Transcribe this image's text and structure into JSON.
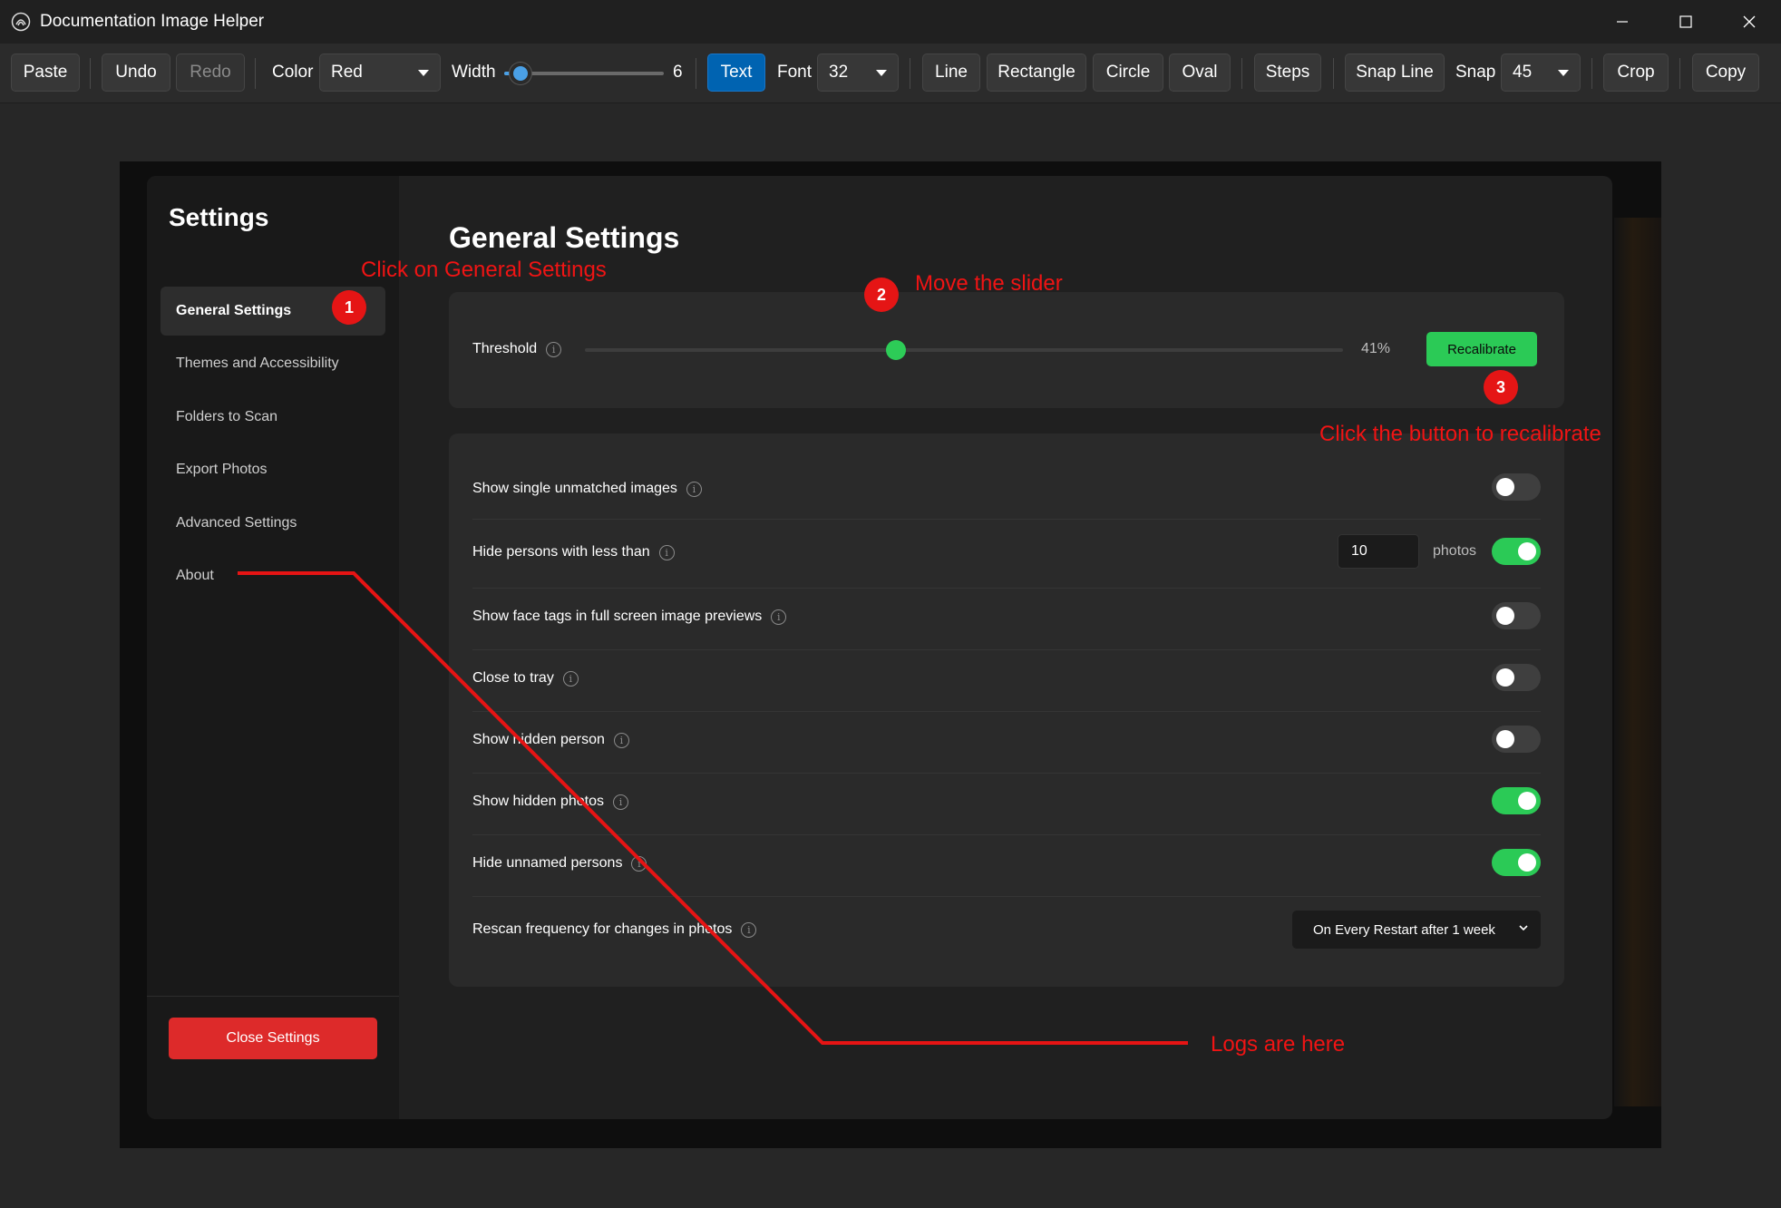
{
  "window": {
    "title": "Documentation Image Helper"
  },
  "toolbar": {
    "paste": "Paste",
    "undo": "Undo",
    "redo": "Redo",
    "color_label": "Color",
    "color_value": "Red",
    "width_label": "Width",
    "width_value": "6",
    "width_fraction": 0.1,
    "text": "Text",
    "font_label": "Font",
    "font_value": "32",
    "line": "Line",
    "rectangle": "Rectangle",
    "circle": "Circle",
    "oval": "Oval",
    "steps": "Steps",
    "snap_line": "Snap Line",
    "snap_label": "Snap",
    "snap_value": "45",
    "crop": "Crop",
    "copy": "Copy",
    "accent": "#0063b1"
  },
  "sidebar": {
    "title": "Settings",
    "items": [
      {
        "label": "General Settings"
      },
      {
        "label": "Themes and Accessibility"
      },
      {
        "label": "Folders to Scan"
      },
      {
        "label": "Export Photos"
      },
      {
        "label": "Advanced Settings"
      },
      {
        "label": "About"
      }
    ],
    "close_button": "Close Settings"
  },
  "main": {
    "title": "General Settings",
    "threshold": {
      "label": "Threshold",
      "value_text": "41%",
      "value": 0.41,
      "button": "Recalibrate"
    },
    "settings": [
      {
        "label": "Show single unmatched images",
        "on": false
      },
      {
        "label": "Hide persons with less than",
        "on": true,
        "input_value": "10",
        "suffix": "photos"
      },
      {
        "label": "Show face tags in full screen image previews",
        "on": false
      },
      {
        "label": "Close to tray",
        "on": false
      },
      {
        "label": "Show hidden person",
        "on": false
      },
      {
        "label": "Show hidden photos",
        "on": true
      },
      {
        "label": "Hide unnamed persons",
        "on": true
      },
      {
        "label": "Rescan frequency for changes in photos",
        "select_value": "On Every Restart after 1 week"
      }
    ],
    "accent_green": "#2bca56"
  },
  "annotations": {
    "step1_text": "Click on General Settings",
    "step1_num": "1",
    "step2_text": "Move the slider",
    "step2_num": "2",
    "step3_text": "Click the button to recalibrate",
    "step3_num": "3",
    "logs_text": "Logs are here",
    "color": "#f01414"
  }
}
